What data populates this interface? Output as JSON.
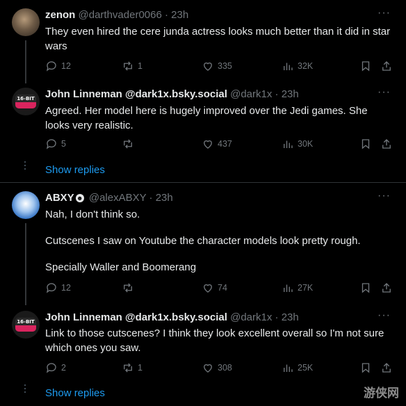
{
  "tweets": [
    {
      "name": "zenon",
      "handle": "@darthvader0066",
      "sep": "·",
      "time": "23h",
      "text": "They even hired the cere junda actress looks much better than it did in star wars",
      "replies": "12",
      "retweets": "1",
      "likes": "335",
      "views": "32K"
    },
    {
      "name": "John Linneman @dark1x.bsky.social",
      "handle": "@dark1x",
      "sep": "·",
      "time": "23h",
      "text": "Agreed. Her model here is hugely improved over the Jedi games. She looks very realistic.",
      "replies": "5",
      "retweets": "",
      "likes": "437",
      "views": "30K",
      "avatar_text": "16-BIT"
    },
    {
      "name": "ABXY",
      "handle": "@alexABXY",
      "sep": "·",
      "time": "23h",
      "text_lines": [
        "Nah, I don't think so.",
        "Cutscenes I saw on Youtube the character models look pretty rough.",
        "Specially Waller and Boomerang"
      ],
      "replies": "12",
      "retweets": "",
      "likes": "74",
      "views": "27K"
    },
    {
      "name": "John Linneman @dark1x.bsky.social",
      "handle": "@dark1x",
      "sep": "·",
      "time": "23h",
      "text": "Link to those cutscenes? I think they look excellent overall so I'm not sure which ones you saw.",
      "replies": "2",
      "retweets": "1",
      "likes": "308",
      "views": "25K",
      "avatar_text": "16-BIT"
    }
  ],
  "show_replies": "Show replies",
  "more_icon": "···",
  "watermark": "游侠网"
}
